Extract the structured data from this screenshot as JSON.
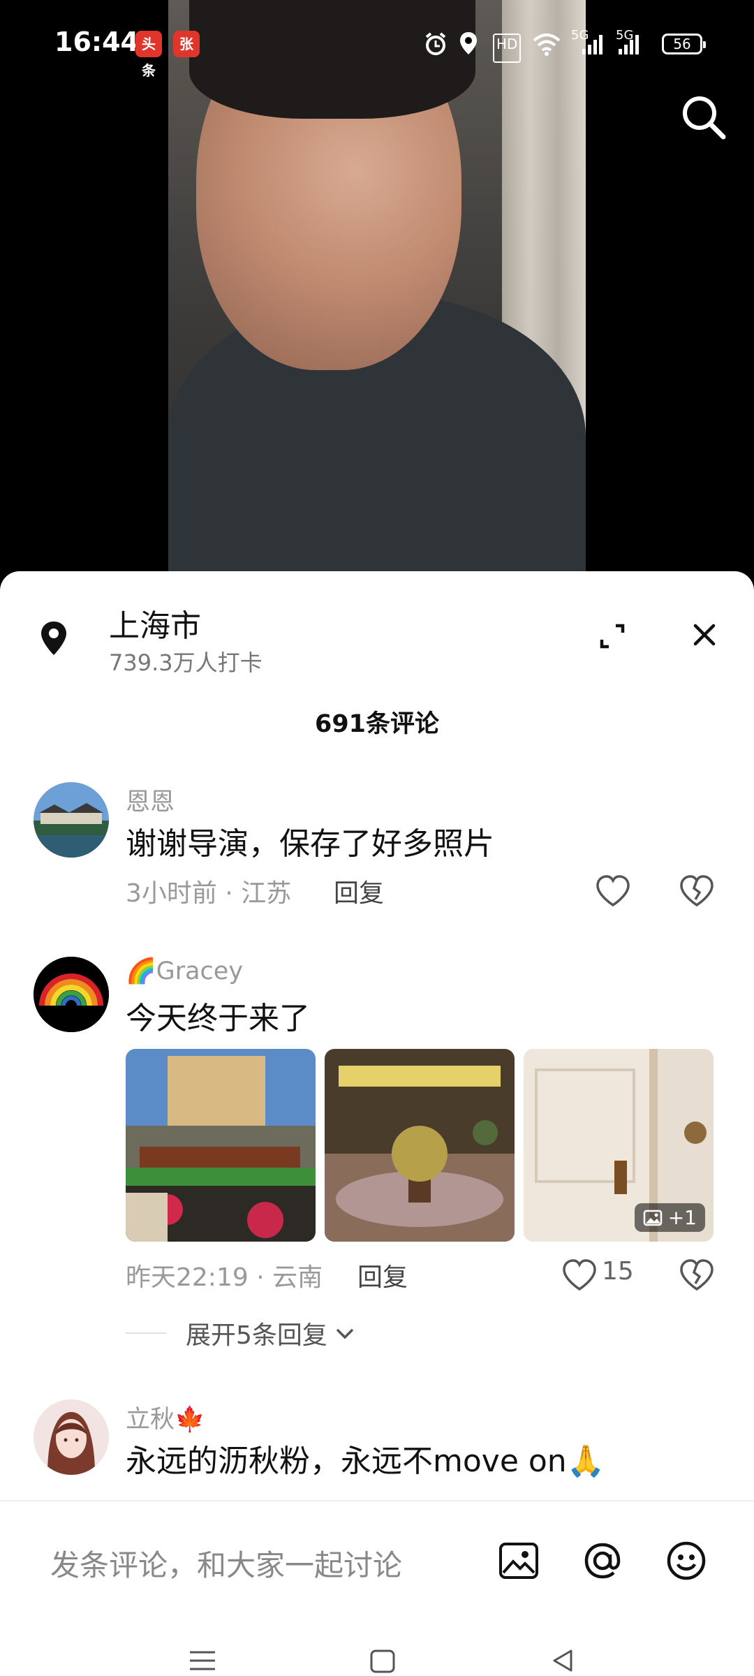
{
  "status_bar": {
    "time": "16:44",
    "app_badges": [
      "头条",
      "张"
    ],
    "hd_label": "HD",
    "network_1": "5G",
    "network_2": "5G",
    "battery": "56"
  },
  "location": {
    "name": "上海市",
    "checkins": "739.3万人打卡"
  },
  "comment_count": "691条评论",
  "comments": [
    {
      "user": "恩恩",
      "text": "谢谢导演，保存了好多照片",
      "meta": "3小时前 · 江苏",
      "reply": "回复"
    },
    {
      "user": "🌈Gracey",
      "text": "今天终于来了",
      "meta": "昨天22:19 · 云南",
      "reply": "回复",
      "likes": "15",
      "photo_more": "+1",
      "expand_replies": "展开5条回复"
    },
    {
      "user": "立秋🍁",
      "text": "永远的沥秋粉，永远不move on🙏"
    }
  ],
  "input": {
    "placeholder": "发条评论，和大家一起讨论"
  },
  "colors": {
    "panel_bg": "#ffffff",
    "text_primary": "#111111",
    "text_secondary": "#999999"
  }
}
